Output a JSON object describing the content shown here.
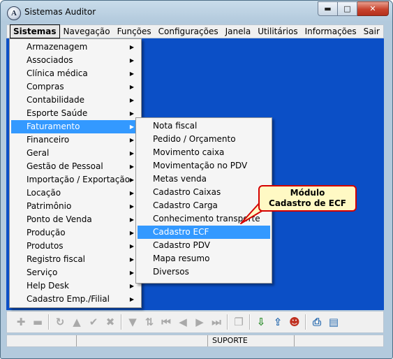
{
  "window": {
    "title": "Sistemas Auditor",
    "app_icon_letter": "A",
    "controls": {
      "minimize": "▬",
      "maximize": "□",
      "close": "✕"
    }
  },
  "menubar": {
    "items": [
      "Sistemas",
      "Navegação",
      "Funções",
      "Configurações",
      "Janela",
      "Utilitários",
      "Informações",
      "Sair"
    ]
  },
  "sistemas_menu": {
    "items": [
      "Armazenagem",
      "Associados",
      "Clínica médica",
      "Compras",
      "Contabilidade",
      "Esporte  Saúde",
      "Faturamento",
      "Financeiro",
      "Geral",
      "Gestão de Pessoal",
      "Importação / Exportação",
      "Locação",
      "Patrimônio",
      "Ponto de Venda",
      "Produção",
      "Produtos",
      "Registro fiscal",
      "Serviço",
      "Help Desk",
      "Cadastro Emp./Filial"
    ],
    "highlighted": "Faturamento",
    "submenu_arrow": "▶"
  },
  "faturamento_submenu": {
    "items": [
      "Nota fiscal",
      "Pedido / Orçamento",
      "Movimento caixa",
      "Movimentação no PDV",
      "Metas venda",
      "Cadastro Caixas",
      "Cadastro Carga",
      "Conhecimento transporte",
      "Cadastro ECF",
      "Cadastro PDV",
      "Mapa resumo",
      "Diversos"
    ],
    "highlighted": "Cadastro ECF"
  },
  "callout": {
    "line1": "Módulo",
    "line2": "Cadastro de ECF",
    "border_color": "#d40000",
    "fill_color": "#fff9c4"
  },
  "toolbar": {
    "buttons": [
      {
        "name": "add-icon",
        "glyph": "✚",
        "enabled": false
      },
      {
        "name": "remove-icon",
        "glyph": "▬",
        "enabled": false
      },
      {
        "name": "refresh-icon",
        "glyph": "↻",
        "enabled": false
      },
      {
        "name": "up-icon",
        "glyph": "▲",
        "enabled": false
      },
      {
        "name": "confirm-icon",
        "glyph": "✔",
        "enabled": false
      },
      {
        "name": "cancel-icon",
        "glyph": "✖",
        "enabled": false
      },
      {
        "name": "filter-icon",
        "glyph": "▼",
        "enabled": false
      },
      {
        "name": "sort-icon",
        "glyph": "⇅",
        "enabled": false
      },
      {
        "name": "first-icon",
        "glyph": "⏮",
        "enabled": false
      },
      {
        "name": "prev-icon",
        "glyph": "◀",
        "enabled": false
      },
      {
        "name": "next-icon",
        "glyph": "▶",
        "enabled": false
      },
      {
        "name": "last-icon",
        "glyph": "⏭",
        "enabled": false
      },
      {
        "name": "copy-icon",
        "glyph": "❐",
        "enabled": false
      },
      {
        "name": "export-icon",
        "glyph": "⇩",
        "enabled": true
      },
      {
        "name": "import-icon",
        "glyph": "⇪",
        "enabled": true
      },
      {
        "name": "users-icon",
        "glyph": "☻",
        "enabled": true
      },
      {
        "name": "print-icon",
        "glyph": "⎙",
        "enabled": true
      },
      {
        "name": "report-icon",
        "glyph": "▤",
        "enabled": true
      }
    ]
  },
  "statusbar": {
    "fields": [
      "",
      "",
      "SUPORTE",
      ""
    ]
  },
  "colors": {
    "client_bg": "#0b4fc6",
    "highlight": "#3399ff"
  }
}
